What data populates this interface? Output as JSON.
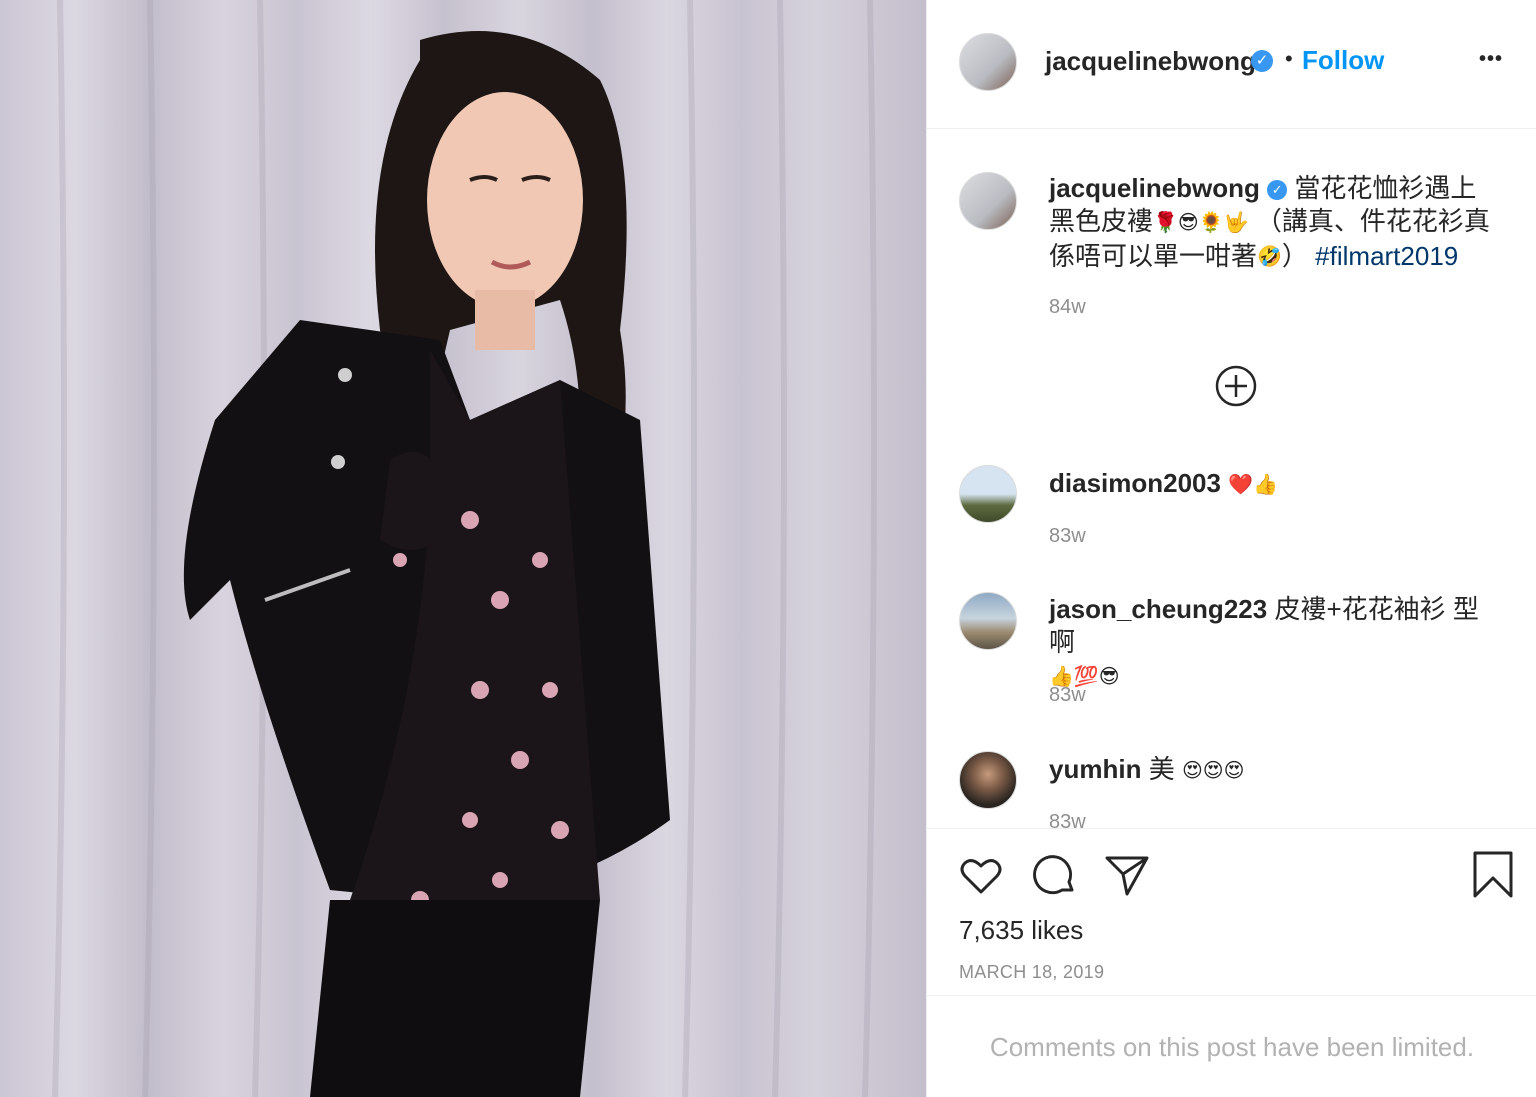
{
  "post": {
    "username": "jacquelinebwong",
    "verified_icon": "verified-badge-icon",
    "follow_separator": "•",
    "follow_label": "Follow",
    "more_icon": "more-options-icon",
    "more_label": "•••"
  },
  "caption": {
    "username": "jacquelinebwong",
    "text_part1": "當花花恤衫遇上黑色皮褸",
    "emojis1": "🌹😎🌻🤟",
    "text_part2": "（講真、件花花衫真係唔可以單一咁著",
    "emoji2": "🤣",
    "text_part3": "）",
    "hashtag": "#filmart2019",
    "time": "84w"
  },
  "load_more_icon": "plus-circle-icon",
  "comments": [
    {
      "username": "diasimon2003",
      "text": "",
      "emojis": "❤️👍",
      "time": "83w"
    },
    {
      "username": "jason_cheung223",
      "text": "皮褸+花花袖衫 型啊",
      "emojis": "👍💯😎",
      "time": "83w"
    },
    {
      "username": "yumhin",
      "text": "美",
      "emojis": "😍😍😍",
      "time": "83w"
    }
  ],
  "actions": {
    "like_icon": "heart-icon",
    "comment_icon": "comment-icon",
    "share_icon": "send-icon",
    "save_icon": "bookmark-icon"
  },
  "likes": "7,635 likes",
  "date": "MARCH 18, 2019",
  "comments_limited": "Comments on this post have been limited.",
  "colors": {
    "accent": "#0095f6",
    "muted": "#8e8e8e",
    "text": "#262626",
    "verified": "#3897f0"
  }
}
